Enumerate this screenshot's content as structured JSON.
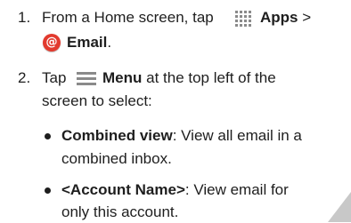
{
  "steps": [
    {
      "number": "1.",
      "lines": [
        {
          "text_before": "From a Home screen, tap",
          "icon": "apps-grid-icon",
          "bold": "Apps",
          "text_after": ">"
        },
        {
          "icon": "email-app-icon",
          "bold": "Email",
          "text_after": "."
        }
      ]
    },
    {
      "number": "2.",
      "lines": [
        {
          "text_before": "Tap",
          "icon": "menu-icon",
          "bold": "Menu",
          "text_after": "at the top left of the"
        },
        {
          "text_after": "screen to select:"
        }
      ],
      "bullets": [
        {
          "bold": "Combined view",
          "text_line1": ": View all email in a",
          "text_line2": "combined inbox."
        },
        {
          "bold": "<Account Name>",
          "text_line1": ": View email for",
          "text_line2": "only this account."
        }
      ]
    }
  ],
  "colors": {
    "text": "#1e1e1e",
    "icon_gray": "#8a8a8a",
    "email_red": "#e23a2e",
    "corner_tab": "#c8c8c8"
  }
}
